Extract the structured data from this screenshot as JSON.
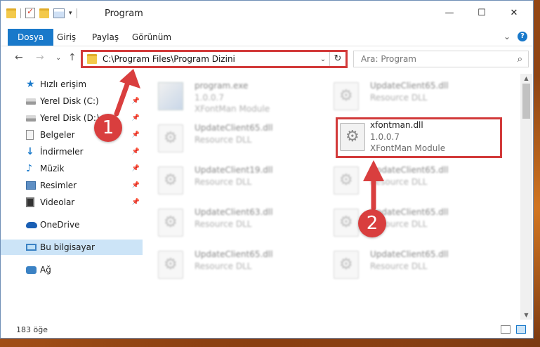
{
  "window": {
    "title": "Program",
    "controls": {
      "minimize": "—",
      "maximize": "☐",
      "close": "✕"
    }
  },
  "ribbon": {
    "tabs": [
      "Dosya",
      "Giriş",
      "Paylaş",
      "Görünüm"
    ],
    "expand": "⌄",
    "help": "?"
  },
  "nav": {
    "back": "←",
    "forward": "→",
    "dropdown": "⌄",
    "up": "↑",
    "address": "C:\\Program Files\\Program Dizini",
    "address_chevron": "⌄",
    "refresh": "↻",
    "search_placeholder": "Ara: Program",
    "search_icon": "⌕"
  },
  "sidebar": {
    "items": [
      {
        "label": "Hızlı erişim",
        "icon": "star-icon",
        "pinned": false
      },
      {
        "label": "Yerel Disk (C:)",
        "icon": "disk-icon",
        "pinned": true
      },
      {
        "label": "Yerel Disk (D:)",
        "icon": "disk-icon",
        "pinned": true
      },
      {
        "label": "Belgeler",
        "icon": "documents-icon",
        "pinned": true
      },
      {
        "label": "İndirmeler",
        "icon": "downloads-icon",
        "pinned": true
      },
      {
        "label": "Müzik",
        "icon": "music-icon",
        "pinned": true
      },
      {
        "label": "Resimler",
        "icon": "pictures-icon",
        "pinned": true
      },
      {
        "label": "Videolar",
        "icon": "videos-icon",
        "pinned": true
      },
      {
        "label": "OneDrive",
        "icon": "onedrive-icon",
        "pinned": false
      },
      {
        "label": "Bu bilgisayar",
        "icon": "this-pc-icon",
        "pinned": false,
        "selected": true
      },
      {
        "label": "Ağ",
        "icon": "network-icon",
        "pinned": false
      }
    ]
  },
  "files": [
    {
      "name": "program.exe",
      "line1": "1.0.0.7",
      "line2": "XFontMan Module",
      "icon": "exe-icon",
      "blurred": true
    },
    {
      "name": "UpdateClient65.dll",
      "line1": "Resource DLL",
      "icon": "dll-icon",
      "blurred": true
    },
    {
      "name": "UpdateClient65.dll",
      "line1": "Resource DLL",
      "icon": "dll-icon",
      "blurred": true
    },
    {
      "name": "xfontman.dll",
      "line1": "1.0.0.7",
      "line2": "XFontMan Module",
      "icon": "dll-icon",
      "blurred": false,
      "highlighted": true
    },
    {
      "name": "UpdateClient19.dll",
      "line1": "Resource DLL",
      "icon": "dll-icon",
      "blurred": true
    },
    {
      "name": "UpdateClient65.dll",
      "line1": "Resource DLL",
      "icon": "dll-icon",
      "blurred": true
    },
    {
      "name": "UpdateClient63.dll",
      "line1": "Resource DLL",
      "icon": "dll-icon",
      "blurred": true
    },
    {
      "name": "UpdateClient65.dll",
      "line1": "Resource DLL",
      "icon": "dll-icon",
      "blurred": true
    },
    {
      "name": "UpdateClient65.dll",
      "line1": "Resource DLL",
      "icon": "dll-icon",
      "blurred": true
    },
    {
      "name": "UpdateClient65.dll",
      "line1": "Resource DLL",
      "icon": "dll-icon",
      "blurred": true
    }
  ],
  "status": {
    "count": "183 öğe"
  },
  "callouts": {
    "one": "1",
    "two": "2"
  },
  "colors": {
    "accent": "#1979ca",
    "highlight": "#d23a3a",
    "selection": "#cce4f7"
  }
}
